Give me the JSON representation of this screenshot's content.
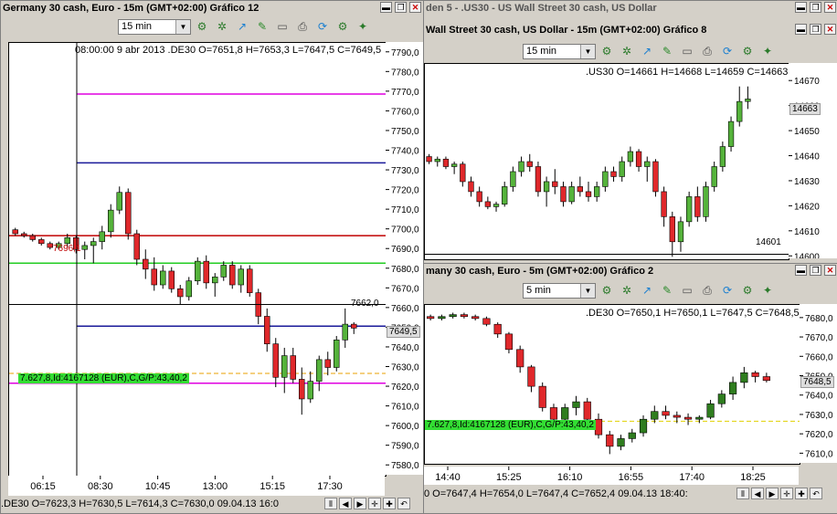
{
  "colors": {
    "up": "#55b33b",
    "down": "#e0282b",
    "upDark": "#2f7d1f",
    "magenta": "#e000e0",
    "navy": "#1a1a9a",
    "darkred": "#c00000",
    "green": "#22cc22",
    "orange": "#e8a000",
    "yellow": "#e0d000"
  },
  "win1": {
    "title": "Germany 30 cash, Euro - 15m (GMT+02:00)   Gráfico 12",
    "timeframe": "15 min",
    "header": "08:00:00 9 abr 2013  .DE30 O=7651,8 H=7653,3 L=7647,5 C=7649,5",
    "ticks": [
      "7790,0",
      "7780,0",
      "7770,0",
      "7760,0",
      "7750,0",
      "7740,0",
      "7730,0",
      "7720,0",
      "7710,0",
      "7700,0",
      "7690,0",
      "7680,0",
      "7670,0",
      "7660,0",
      "7650,0",
      "7640,0",
      "7630,0",
      "7620,0",
      "7610,0",
      "7600,0",
      "7590,0",
      "7580,0"
    ],
    "price_tag": "7649,5",
    "hi_label": "7662,0",
    "left_tag": "7696,1",
    "order_label": "7.627,8,Id:4167128 (EUR),C,G/P:43,40,2",
    "xlabels": [
      "06:15",
      "08:30",
      "10:45",
      "13:00",
      "15:15",
      "17:30"
    ],
    "status": ".DE30 O=7623,3 H=7630,5 L=7614,3 C=7630,0  09.04.13 16:0"
  },
  "win2": {
    "title": "Gráfico 8 — Wall Street 30 cash, US Dollar - 15m (GMT+02:00)",
    "topbar": "den 5 - .US30 - US Wall Street 30 cash, US Dollar",
    "titlebar": "Wall Street 30 cash, US Dollar - 15m (GMT+02:00)   Gráfico 8",
    "timeframe": "15 min",
    "header": ".US30 O=14661 H=14668 L=14659 C=14663",
    "ticks": [
      "14670",
      "14660",
      "14650",
      "14640",
      "14630",
      "14620",
      "14610",
      "14600"
    ],
    "price_tag": "14663",
    "low_label": "14601"
  },
  "win3": {
    "titlebar": "many 30 cash, Euro - 5m (GMT+02:00)   Gráfico 2",
    "timeframe": "5 min",
    "header": ".DE30 O=7650,1 H=7650,1 L=7647,5 C=7648,5",
    "ticks": [
      "7680,0",
      "7670,0",
      "7660,0",
      "7650,0",
      "7640,0",
      "7630,0",
      "7620,0",
      "7610,0"
    ],
    "price_tag": "7648,5",
    "order_label": "7.627,8,Id:4167128 (EUR),C,G/P:43,40,2",
    "xlabels": [
      "14:40",
      "15:25",
      "16:10",
      "16:55",
      "17:40",
      "18:25"
    ],
    "status": "0 O=7647,4 H=7654,0 L=7647,4 C=7652,4  09.04.13 18:40:"
  },
  "chart_data": [
    {
      "type": "candlestick",
      "name": ".DE30 15m",
      "ylim": [
        7575,
        7795
      ],
      "series": [
        [
          7700,
          7701,
          7697,
          7698
        ],
        [
          7698,
          7699,
          7696,
          7697
        ],
        [
          7697,
          7698,
          7694,
          7695
        ],
        [
          7695,
          7696,
          7692,
          7693
        ],
        [
          7693,
          7694,
          7690,
          7691
        ],
        [
          7691,
          7694,
          7690,
          7693
        ],
        [
          7693,
          7698,
          7691,
          7696
        ],
        [
          7696,
          7697,
          7688,
          7690
        ],
        [
          7690,
          7694,
          7685,
          7692
        ],
        [
          7692,
          7696,
          7683,
          7694
        ],
        [
          7694,
          7702,
          7690,
          7699
        ],
        [
          7699,
          7713,
          7696,
          7710
        ],
        [
          7710,
          7722,
          7708,
          7719
        ],
        [
          7719,
          7721,
          7695,
          7698
        ],
        [
          7698,
          7700,
          7682,
          7685
        ],
        [
          7685,
          7690,
          7675,
          7680
        ],
        [
          7680,
          7686,
          7669,
          7672
        ],
        [
          7672,
          7682,
          7670,
          7679
        ],
        [
          7679,
          7681,
          7668,
          7670
        ],
        [
          7670,
          7672,
          7662,
          7666
        ],
        [
          7666,
          7676,
          7664,
          7674
        ],
        [
          7674,
          7686,
          7672,
          7684
        ],
        [
          7684,
          7687,
          7670,
          7673
        ],
        [
          7673,
          7678,
          7666,
          7676
        ],
        [
          7676,
          7684,
          7674,
          7682
        ],
        [
          7682,
          7684,
          7670,
          7672
        ],
        [
          7672,
          7682,
          7668,
          7680
        ],
        [
          7680,
          7682,
          7666,
          7668
        ],
        [
          7668,
          7670,
          7652,
          7656
        ],
        [
          7656,
          7660,
          7638,
          7642
        ],
        [
          7642,
          7645,
          7620,
          7625
        ],
        [
          7625,
          7640,
          7617,
          7636
        ],
        [
          7636,
          7640,
          7622,
          7624
        ],
        [
          7624,
          7630,
          7606,
          7614
        ],
        [
          7614,
          7628,
          7612,
          7623
        ],
        [
          7623,
          7636,
          7618,
          7634
        ],
        [
          7634,
          7638,
          7626,
          7630
        ],
        [
          7630,
          7646,
          7628,
          7644
        ],
        [
          7644,
          7660,
          7640,
          7652
        ],
        [
          7652,
          7653,
          7647,
          7650
        ]
      ],
      "hlines": [
        7769,
        7734,
        7697,
        7683,
        7651,
        7627,
        7622
      ]
    },
    {
      "type": "candlestick",
      "name": ".US30 15m",
      "ylim": [
        14599,
        14677
      ],
      "series": [
        [
          14640,
          14641,
          14637,
          14638
        ],
        [
          14638,
          14640,
          14636,
          14639
        ],
        [
          14639,
          14640,
          14635,
          14636
        ],
        [
          14636,
          14638,
          14633,
          14637
        ],
        [
          14637,
          14638,
          14628,
          14630
        ],
        [
          14630,
          14632,
          14624,
          14626
        ],
        [
          14626,
          14628,
          14620,
          14622
        ],
        [
          14622,
          14624,
          14619,
          14620
        ],
        [
          14620,
          14622,
          14618,
          14621
        ],
        [
          14621,
          14630,
          14620,
          14628
        ],
        [
          14628,
          14636,
          14626,
          14634
        ],
        [
          14634,
          14640,
          14632,
          14638
        ],
        [
          14638,
          14641,
          14634,
          14636
        ],
        [
          14636,
          14638,
          14624,
          14626
        ],
        [
          14626,
          14632,
          14620,
          14630
        ],
        [
          14630,
          14635,
          14625,
          14628
        ],
        [
          14628,
          14630,
          14620,
          14622
        ],
        [
          14622,
          14630,
          14621,
          14628
        ],
        [
          14628,
          14632,
          14624,
          14626
        ],
        [
          14626,
          14630,
          14622,
          14624
        ],
        [
          14624,
          14630,
          14622,
          14628
        ],
        [
          14628,
          14636,
          14626,
          14634
        ],
        [
          14634,
          14636,
          14630,
          14632
        ],
        [
          14632,
          14640,
          14630,
          14638
        ],
        [
          14638,
          14644,
          14636,
          14642
        ],
        [
          14642,
          14643,
          14634,
          14636
        ],
        [
          14636,
          14640,
          14630,
          14638
        ],
        [
          14638,
          14639,
          14624,
          14626
        ],
        [
          14626,
          14628,
          14612,
          14616
        ],
        [
          14616,
          14618,
          14600,
          14606
        ],
        [
          14606,
          14616,
          14602,
          14614
        ],
        [
          14614,
          14626,
          14612,
          14624
        ],
        [
          14624,
          14628,
          14614,
          14616
        ],
        [
          14616,
          14630,
          14614,
          14628
        ],
        [
          14628,
          14638,
          14626,
          14636
        ],
        [
          14636,
          14646,
          14634,
          14644
        ],
        [
          14644,
          14656,
          14642,
          14654
        ],
        [
          14654,
          14668,
          14652,
          14662
        ],
        [
          14662,
          14668,
          14659,
          14663
        ]
      ],
      "hlines": [
        14601
      ]
    },
    {
      "type": "candlestick",
      "name": ".DE30 5m",
      "ylim": [
        7605,
        7687
      ],
      "series": [
        [
          7681,
          7682,
          7679,
          7680
        ],
        [
          7680,
          7682,
          7679,
          7681
        ],
        [
          7681,
          7683,
          7680,
          7682
        ],
        [
          7682,
          7683,
          7680,
          7681
        ],
        [
          7681,
          7682,
          7679,
          7680
        ],
        [
          7680,
          7681,
          7676,
          7677
        ],
        [
          7677,
          7678,
          7670,
          7672
        ],
        [
          7672,
          7673,
          7662,
          7664
        ],
        [
          7664,
          7666,
          7652,
          7655
        ],
        [
          7655,
          7656,
          7642,
          7645
        ],
        [
          7645,
          7647,
          7632,
          7634
        ],
        [
          7634,
          7636,
          7624,
          7628
        ],
        [
          7628,
          7636,
          7625,
          7634
        ],
        [
          7634,
          7640,
          7630,
          7637
        ],
        [
          7637,
          7639,
          7626,
          7628
        ],
        [
          7628,
          7631,
          7618,
          7620
        ],
        [
          7620,
          7622,
          7610,
          7614
        ],
        [
          7614,
          7620,
          7612,
          7618
        ],
        [
          7618,
          7623,
          7616,
          7621
        ],
        [
          7621,
          7630,
          7619,
          7628
        ],
        [
          7628,
          7635,
          7626,
          7632
        ],
        [
          7632,
          7635,
          7628,
          7630
        ],
        [
          7630,
          7632,
          7626,
          7629
        ],
        [
          7629,
          7631,
          7625,
          7628
        ],
        [
          7628,
          7630,
          7626,
          7629
        ],
        [
          7629,
          7638,
          7628,
          7636
        ],
        [
          7636,
          7643,
          7634,
          7641
        ],
        [
          7641,
          7650,
          7638,
          7647
        ],
        [
          7647,
          7655,
          7644,
          7652
        ],
        [
          7652,
          7653,
          7647,
          7650
        ],
        [
          7650,
          7652,
          7647,
          7648
        ]
      ],
      "hlines": [
        7627
      ]
    }
  ]
}
